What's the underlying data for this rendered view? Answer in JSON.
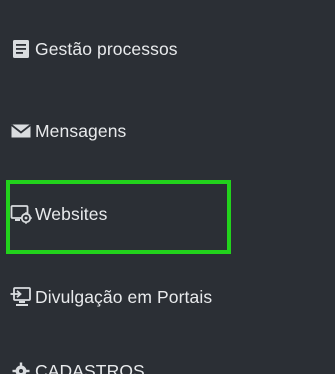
{
  "sidebar": {
    "items": [
      {
        "label": "Gestão processos",
        "icon": "document-icon"
      },
      {
        "label": "Mensagens",
        "icon": "envelope-icon"
      },
      {
        "label": "Websites",
        "icon": "website-settings-icon"
      },
      {
        "label": "Divulgação em Portais",
        "icon": "monitor-login-icon"
      },
      {
        "label": "CADASTROS",
        "icon": "gear-icon"
      }
    ]
  },
  "colors": {
    "background": "#2b2f35",
    "text": "#e8eaec",
    "highlight": "#22d21c"
  }
}
